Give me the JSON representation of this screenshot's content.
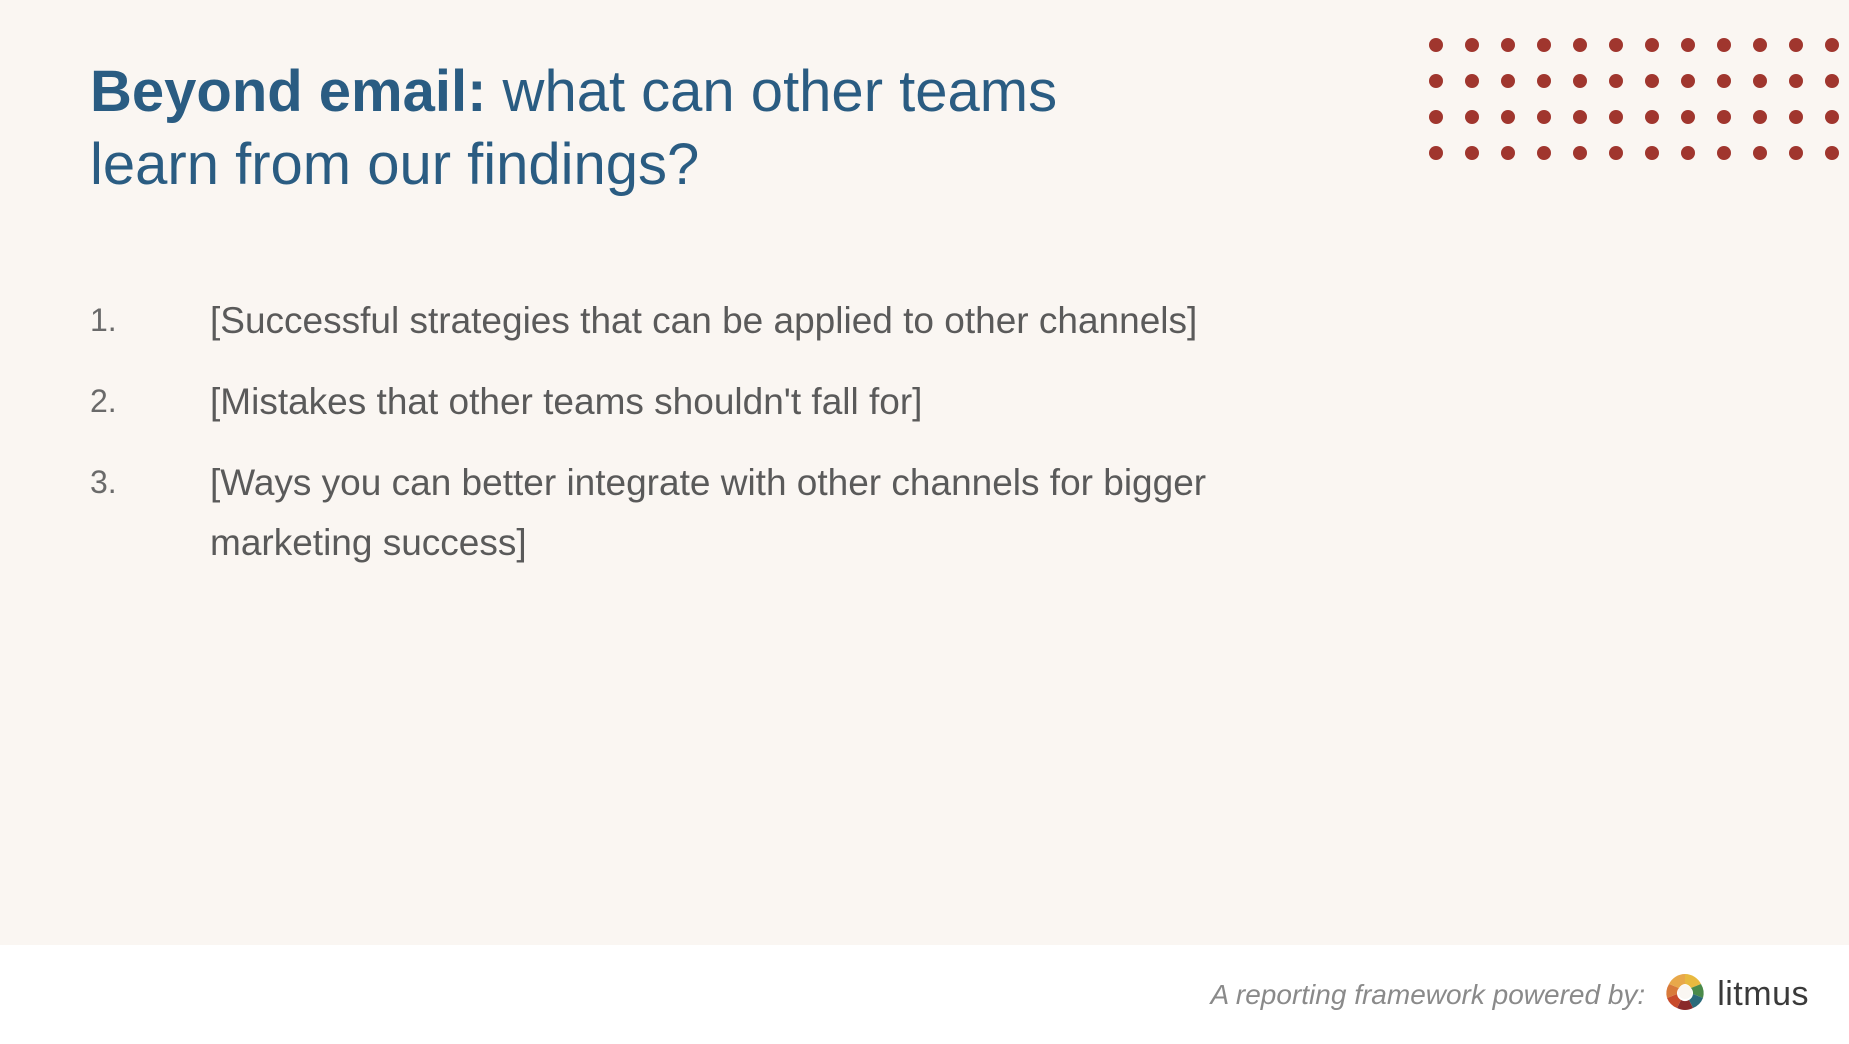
{
  "title": {
    "bold": "Beyond email:",
    "rest": " what can other teams learn from our findings?"
  },
  "list": {
    "items": [
      {
        "number": "1.",
        "text": "[Successful strategies that can be applied to other channels]"
      },
      {
        "number": "2.",
        "text": "[Mistakes that other teams shouldn't fall for]"
      },
      {
        "number": "3.",
        "text": "[Ways you can better integrate with other channels for bigger marketing success]"
      }
    ]
  },
  "footer": {
    "text": "A reporting framework powered by:",
    "brand": "litmus"
  },
  "decor": {
    "dot_count": 48,
    "dot_color": "#a0362e"
  }
}
